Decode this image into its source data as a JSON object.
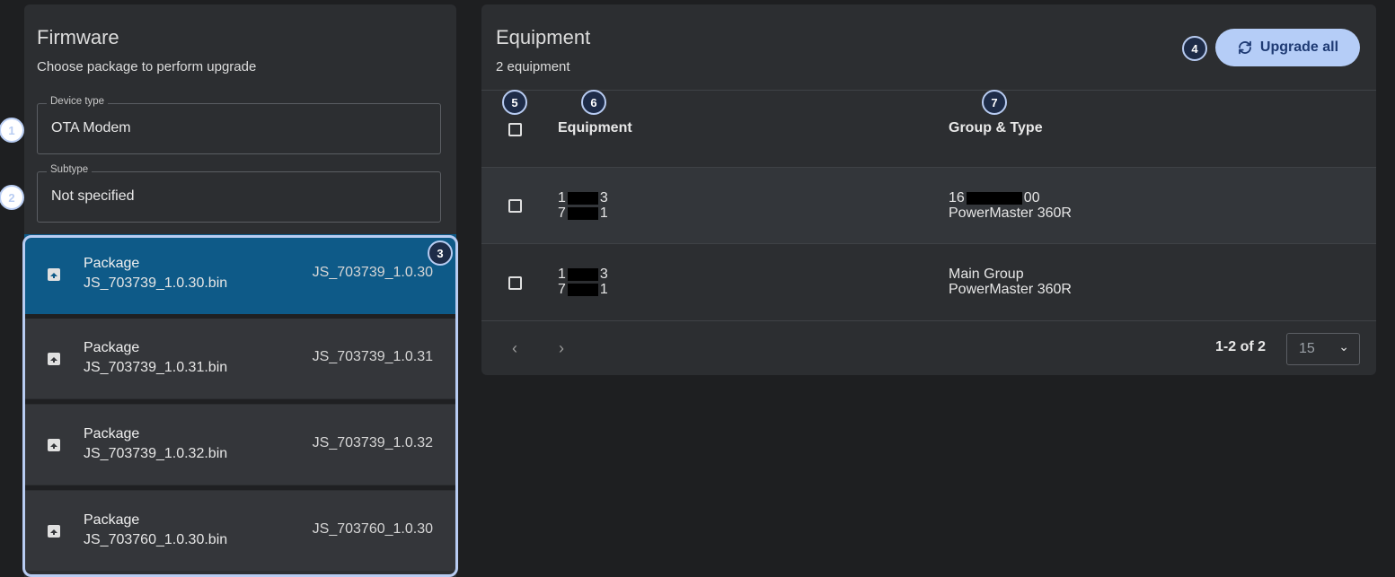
{
  "firmware": {
    "title": "Firmware",
    "subtitle": "Choose package to perform upgrade",
    "device_type": {
      "label": "Device type",
      "value": "OTA Modem"
    },
    "subtype": {
      "label": "Subtype",
      "value": "Not specified"
    },
    "packages": [
      {
        "title": "Package",
        "file": "JS_703739_1.0.30.bin",
        "version": "JS_703739_1.0.30",
        "selected": true
      },
      {
        "title": "Package",
        "file": "JS_703739_1.0.31.bin",
        "version": "JS_703739_1.0.31",
        "selected": false
      },
      {
        "title": "Package",
        "file": "JS_703739_1.0.32.bin",
        "version": "JS_703739_1.0.32",
        "selected": false
      },
      {
        "title": "Package",
        "file": "JS_703760_1.0.30.bin",
        "version": "JS_703760_1.0.30",
        "selected": false
      }
    ]
  },
  "equipment": {
    "title": "Equipment",
    "count_text": "2 equipment",
    "upgrade_all_label": "Upgrade all",
    "columns": {
      "equipment": "Equipment",
      "group_type": "Group & Type"
    },
    "rows": [
      {
        "eq_line1_a": "1",
        "eq_line1_b": "3",
        "eq_line2_a": "7",
        "eq_line2_b": "1",
        "group_a": "16",
        "group_b": "00",
        "type": "PowerMaster 360R"
      },
      {
        "eq_line1_a": "1",
        "eq_line1_b": "3",
        "eq_line2_a": "7",
        "eq_line2_b": "1",
        "group": "Main Group",
        "type": "PowerMaster 360R"
      }
    ],
    "pagination": {
      "prev": "‹",
      "next": "›",
      "range": "1-2 of 2",
      "per_page": "15"
    }
  },
  "annotations": [
    "1",
    "2",
    "3",
    "4",
    "5",
    "6",
    "7"
  ],
  "colors": {
    "accent_selected": "#0e5a88",
    "annotation": "#b8ccf2",
    "button_bg": "#b5cdf7"
  }
}
